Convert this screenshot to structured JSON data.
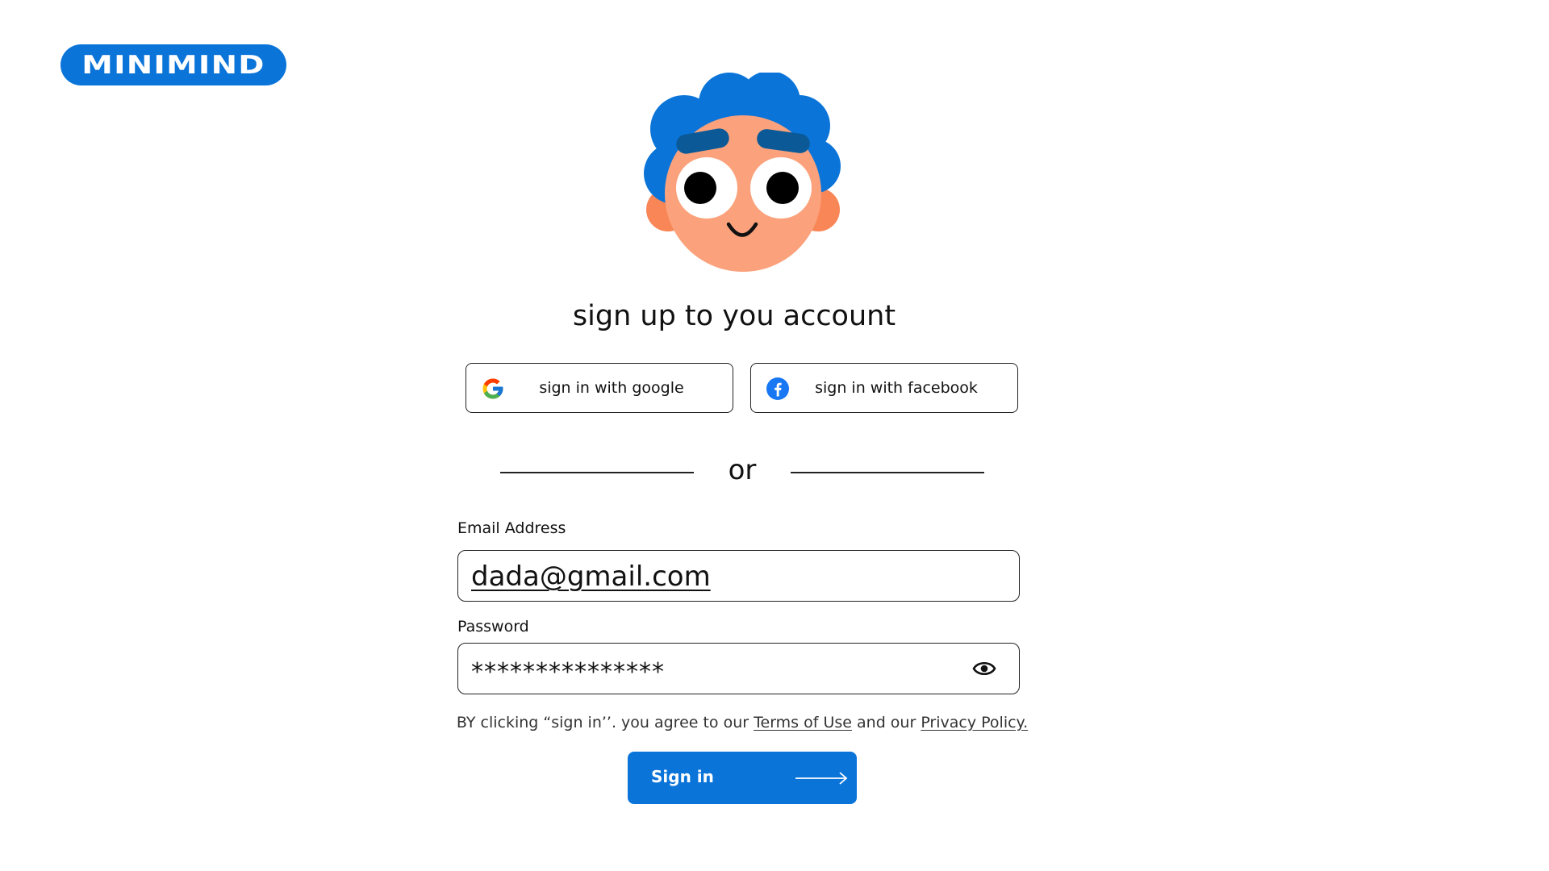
{
  "logo": {
    "text": "MINIMIND"
  },
  "heading": "sign up to you account",
  "social": {
    "google": {
      "label": "sign in with google",
      "icon": "google-icon"
    },
    "facebook": {
      "label": "sign in with facebook",
      "icon": "facebook-icon"
    }
  },
  "divider": {
    "text": "or"
  },
  "form": {
    "email": {
      "label": "Email Address",
      "value": "dada@gmail.com"
    },
    "password": {
      "label": "Password",
      "value": "***************",
      "toggle_icon": "eye-icon"
    }
  },
  "terms": {
    "prefix": "BY clicking “sign in’’. you agree to our ",
    "terms_link": "Terms of Use",
    "middle": " and our ",
    "privacy_link": "Privacy Policy."
  },
  "signin": {
    "label": "Sign in",
    "icon": "arrow-right-icon"
  },
  "colors": {
    "brand": "#0a74d9",
    "hair": "#0a74d9",
    "skin": "#fba27c",
    "ear": "#f88656",
    "eyebrow": "#0b5a97"
  }
}
